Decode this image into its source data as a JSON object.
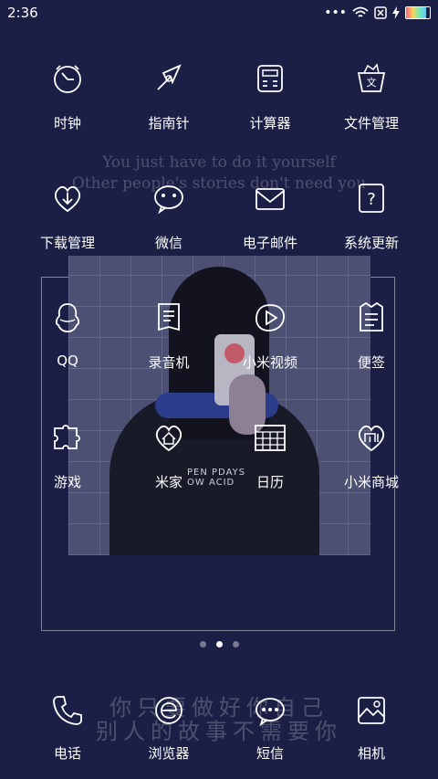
{
  "status_bar": {
    "time": "2:36",
    "signal_dots": "•••",
    "battery_level": 0.85
  },
  "quote_en": {
    "line1": "You just have to do it yourself",
    "line2": "Other people's stories don't need you"
  },
  "quote_zh": {
    "line1": "你只要做好你自己",
    "line2": "别人的故事不需要你"
  },
  "apps": [
    {
      "label": "时钟",
      "icon": "clock-icon"
    },
    {
      "label": "指南针",
      "icon": "compass-icon"
    },
    {
      "label": "计算器",
      "icon": "calculator-icon"
    },
    {
      "label": "文件管理",
      "icon": "file-manager-icon"
    },
    {
      "label": "下载管理",
      "icon": "download-icon"
    },
    {
      "label": "微信",
      "icon": "wechat-icon"
    },
    {
      "label": "电子邮件",
      "icon": "email-icon"
    },
    {
      "label": "系统更新",
      "icon": "system-update-icon"
    },
    {
      "label": "QQ",
      "icon": "qq-icon"
    },
    {
      "label": "录音机",
      "icon": "recorder-icon"
    },
    {
      "label": "小米视频",
      "icon": "video-icon"
    },
    {
      "label": "便签",
      "icon": "notes-icon"
    },
    {
      "label": "游戏",
      "icon": "game-icon"
    },
    {
      "label": "米家",
      "icon": "mijia-icon"
    },
    {
      "label": "日历",
      "icon": "calendar-icon"
    },
    {
      "label": "小米商城",
      "icon": "mi-store-icon"
    }
  ],
  "dock": [
    {
      "label": "电话",
      "icon": "phone-icon"
    },
    {
      "label": "浏览器",
      "icon": "browser-icon"
    },
    {
      "label": "短信",
      "icon": "messages-icon"
    },
    {
      "label": "相机",
      "icon": "camera-icon"
    }
  ],
  "wallpaper_photo": {
    "shirt_line1": "PEN PDAYS",
    "shirt_line2": "OW ACID"
  },
  "page_indicator": {
    "count": 3,
    "active": 1
  }
}
